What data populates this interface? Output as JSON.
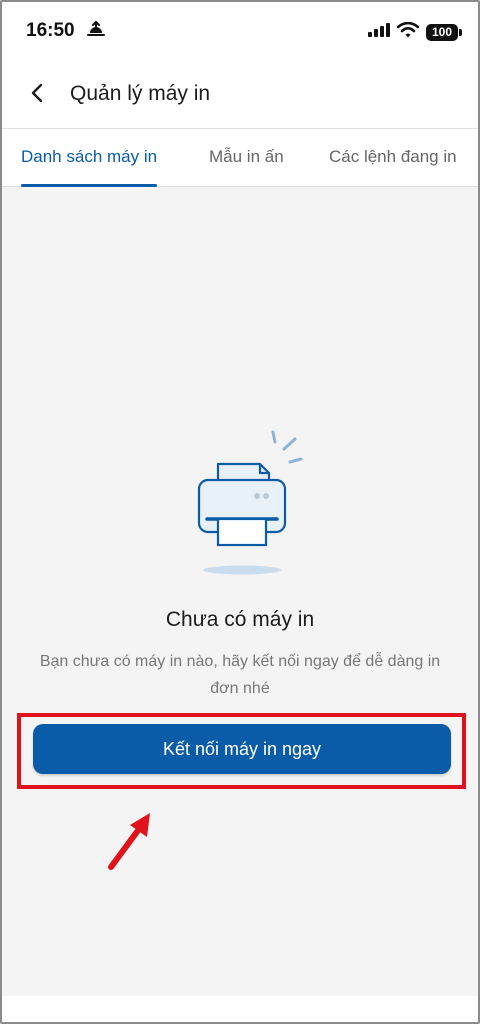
{
  "status_bar": {
    "time": "16:50",
    "battery": "100"
  },
  "header": {
    "title": "Quản lý máy in"
  },
  "tabs": [
    {
      "label": "Danh sách máy in",
      "active": true
    },
    {
      "label": "Mẫu in ấn",
      "active": false
    },
    {
      "label": "Các lệnh đang in",
      "active": false
    }
  ],
  "empty_state": {
    "icon": "printer-icon",
    "title": "Chưa có máy in",
    "description": "Bạn chưa có máy in nào, hãy kết nối ngay để dễ dàng in đơn nhé"
  },
  "actions": {
    "connect_label": "Kết nối máy in ngay"
  },
  "colors": {
    "accent": "#0a5ba8",
    "highlight": "#e0131b",
    "background": "#f4f4f4"
  }
}
